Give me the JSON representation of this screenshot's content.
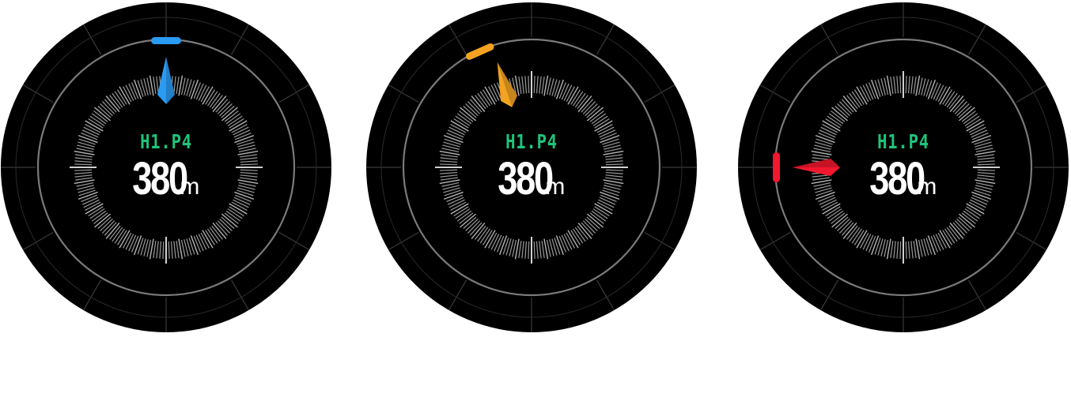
{
  "watches": [
    {
      "hole_label": "H1.P4",
      "distance_value": "380",
      "distance_unit": "m",
      "indicator_color": "#2a9bf2",
      "pointer_color": "#2a9bf2",
      "pointer_bearing_deg": 0,
      "marker_bearing_deg": 0
    },
    {
      "hole_label": "H1.P4",
      "distance_value": "380",
      "distance_unit": "m",
      "indicator_color": "#f3a321",
      "pointer_color": "#f3a321",
      "pointer_bearing_deg": -18,
      "marker_bearing_deg": -24
    },
    {
      "hole_label": "H1.P4",
      "distance_value": "380",
      "distance_unit": "m",
      "indicator_color": "#f2182e",
      "pointer_color": "#f2182e",
      "pointer_bearing_deg": -90,
      "marker_bearing_deg": -90
    }
  ]
}
